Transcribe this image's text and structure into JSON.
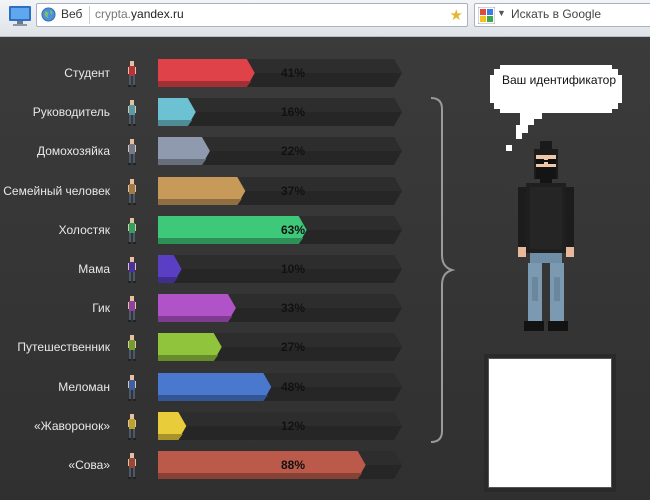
{
  "browser": {
    "tab_label": "Веб",
    "url_prefix": "crypta.",
    "url_domain": "yandex.ru",
    "search_placeholder": "Искать в Google"
  },
  "speech_bubble": "Ваш идентификатор",
  "rows": [
    {
      "label": "Студент",
      "percent_label": "41%",
      "percent": 41,
      "color": "#e0424a"
    },
    {
      "label": "Руководитель",
      "percent_label": "16%",
      "percent": 16,
      "color": "#6cc2d2"
    },
    {
      "label": "Домохозяйка",
      "percent_label": "22%",
      "percent": 22,
      "color": "#8f9aae"
    },
    {
      "label": "Семейный человек",
      "percent_label": "37%",
      "percent": 37,
      "color": "#c79a5a"
    },
    {
      "label": "Холостяк",
      "percent_label": "63%",
      "percent": 63,
      "color": "#3ec879"
    },
    {
      "label": "Мама",
      "percent_label": "10%",
      "percent": 10,
      "color": "#5a3ec4"
    },
    {
      "label": "Гик",
      "percent_label": "33%",
      "percent": 33,
      "color": "#b052c8"
    },
    {
      "label": "Путешественник",
      "percent_label": "27%",
      "percent": 27,
      "color": "#8fc43c"
    },
    {
      "label": "Меломан",
      "percent_label": "48%",
      "percent": 48,
      "color": "#4a78cf"
    },
    {
      "label": "«Жаворонок»",
      "percent_label": "12%",
      "percent": 12,
      "color": "#e8cc3a"
    },
    {
      "label": "«Сова»",
      "percent_label": "88%",
      "percent": 88,
      "color": "#bb5a4a"
    }
  ]
}
